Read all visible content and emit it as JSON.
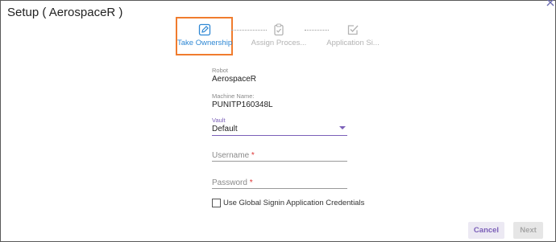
{
  "dialog": {
    "title": "Setup ( AerospaceR )",
    "close_icon": "close-icon"
  },
  "steps": [
    {
      "label": "Take Ownership",
      "icon": "edit-pencil-icon",
      "state": "active",
      "color": "#2f88d4"
    },
    {
      "label": "Assign Proces...",
      "icon": "clipboard-check-icon",
      "state": "inactive"
    },
    {
      "label": "Application Si...",
      "icon": "check-box-icon",
      "state": "inactive"
    }
  ],
  "form": {
    "robot": {
      "caption": "Robot",
      "value": "AerospaceR"
    },
    "machine": {
      "caption": "Machine Name:",
      "value": "PUNITP160348L"
    },
    "vault": {
      "caption": "Vault",
      "value": "Default",
      "icon": "dropdown-caret-icon"
    },
    "username": {
      "placeholder": "Username",
      "required_mark": "*"
    },
    "password": {
      "placeholder": "Password",
      "required_mark": "*"
    },
    "global_credentials": {
      "label": "Use Global Signin Application Credentials",
      "checked": false
    }
  },
  "buttons": {
    "cancel": "Cancel",
    "next": "Next"
  },
  "colors": {
    "accent": "#7b5fb8",
    "highlight_border": "#f07c2e",
    "step_active": "#2f88d4"
  }
}
